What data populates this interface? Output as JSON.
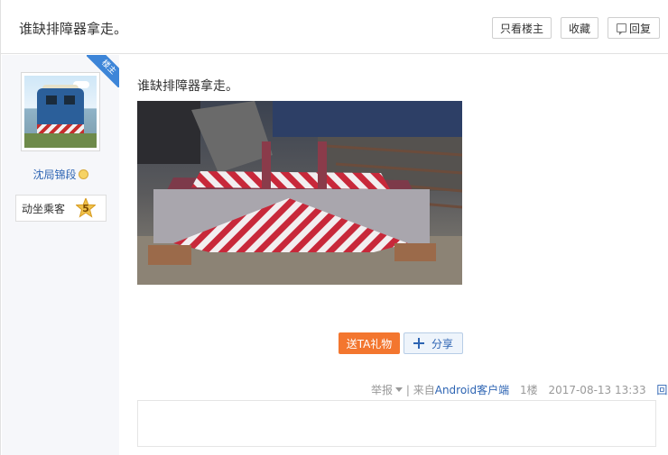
{
  "header": {
    "title": "谁缺排障器拿走。",
    "only_op_label": "只看楼主",
    "favorite_label": "收藏",
    "reply_label": "回复"
  },
  "user": {
    "op_badge": "楼主",
    "name": "沈局锦段",
    "level_name": "动坐乘客",
    "level_number": "5"
  },
  "post": {
    "text": "谁缺排障器拿走。",
    "gift_label": "送TA礼物",
    "share_label": "分享"
  },
  "meta": {
    "report_label": "举报",
    "separator": "|",
    "from_prefix": "来自",
    "client_name": "Android客户端",
    "floor": "1楼",
    "timestamp": "2017-08-13 13:33",
    "reply_label": "回复"
  },
  "colors": {
    "link": "#2d64b3",
    "gift_orange": "#f3762f",
    "badge_blue": "#3d85d8"
  }
}
